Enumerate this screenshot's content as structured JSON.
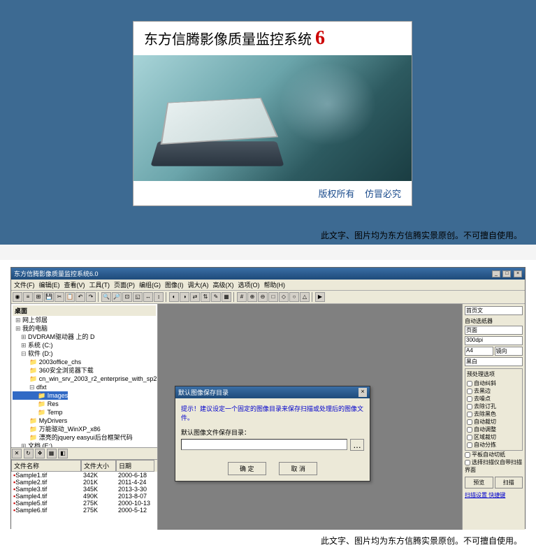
{
  "splash": {
    "title_main": "东方信腾影像质量监控系统",
    "version": "6",
    "copyright": "版权所有",
    "warning": "仿冒必究"
  },
  "watermark": "此文字、图片均为东方信腾实景原创。不可擅自使用。",
  "app": {
    "title": "东方信腾影像质量监控系统6.0",
    "menu": [
      "文件(F)",
      "编辑(E)",
      "查看(V)",
      "工具(T)",
      "页面(P)",
      "编组(G)",
      "图像(I)",
      "调大(A)",
      "高级(X)",
      "选项(O)",
      "帮助(H)"
    ],
    "tree_header": "桌面",
    "tree": [
      {
        "l": 0,
        "icon": "⊞",
        "t": "网上邻居"
      },
      {
        "l": 0,
        "icon": "⊞",
        "t": "我的电脑"
      },
      {
        "l": 1,
        "icon": "⊞",
        "t": "DVDRAM驱动器 上的 D"
      },
      {
        "l": 1,
        "icon": "⊞",
        "t": "系统 (C:)"
      },
      {
        "l": 1,
        "icon": "⊟",
        "t": "软件 (D:)"
      },
      {
        "l": 2,
        "icon": "📁",
        "t": "2003office_chs"
      },
      {
        "l": 2,
        "icon": "📁",
        "t": "360安全浏览器下载"
      },
      {
        "l": 2,
        "icon": "📁",
        "t": "cn_win_srv_2003_r2_enterprise_with_sp2"
      },
      {
        "l": 2,
        "icon": "⊟",
        "t": "dfxt"
      },
      {
        "l": 3,
        "icon": "📁",
        "t": "Images",
        "sel": true
      },
      {
        "l": 3,
        "icon": "📁",
        "t": "Res"
      },
      {
        "l": 3,
        "icon": "📁",
        "t": "Temp"
      },
      {
        "l": 2,
        "icon": "📁",
        "t": "MyDrivers"
      },
      {
        "l": 2,
        "icon": "📁",
        "t": "万能驱动_WinXP_x86"
      },
      {
        "l": 2,
        "icon": "📁",
        "t": "漂亮的jquery easyui后台框架代码"
      },
      {
        "l": 1,
        "icon": "⊞",
        "t": "文档 (E:)"
      }
    ],
    "filelist": {
      "headers": [
        "文件名称",
        "文件大小",
        "日期"
      ],
      "rows": [
        {
          "name": "Sample1.tif",
          "size": "342K",
          "date": "2000-6-18"
        },
        {
          "name": "Sample2.tif",
          "size": "201K",
          "date": "2011-4-24"
        },
        {
          "name": "Sample3.tif",
          "size": "345K",
          "date": "2013-3-30"
        },
        {
          "name": "Sample4.tif",
          "size": "490K",
          "date": "2013-8-07"
        },
        {
          "name": "Sample5.tif",
          "size": "275K",
          "date": "2000-10-13"
        },
        {
          "name": "Sample6.tif",
          "size": "275K",
          "date": "2000-5-12"
        }
      ]
    },
    "right": {
      "scanner": "首页文",
      "source_label": "自动选纸器",
      "paper": "页面",
      "dpi": "300dpi",
      "size1": "A4",
      "size2": "镜向",
      "color": "黑白",
      "group_title": "预处理选项",
      "options": [
        "自动纠斜",
        "去黑边",
        "去噪点",
        "去除订孔",
        "去除黑色",
        "自动裁切",
        "自动调整",
        "区域裁切",
        "自动分拣"
      ],
      "chk_flat": "平板自动切纸",
      "chk_scan": "选择扫描仪自带扫描界面",
      "btn_preview": "预览",
      "btn_scan": "扫描",
      "link1": "扫描设置",
      "link2": "快捷键"
    }
  },
  "dialog": {
    "title": "默认图像保存目录",
    "hint": "提示！建议设定一个固定的图像目录来保存扫描或处理后的图像文件。",
    "label": "默认图像文件保存目录：",
    "browse": "...",
    "ok": "确 定",
    "cancel": "取 消"
  }
}
